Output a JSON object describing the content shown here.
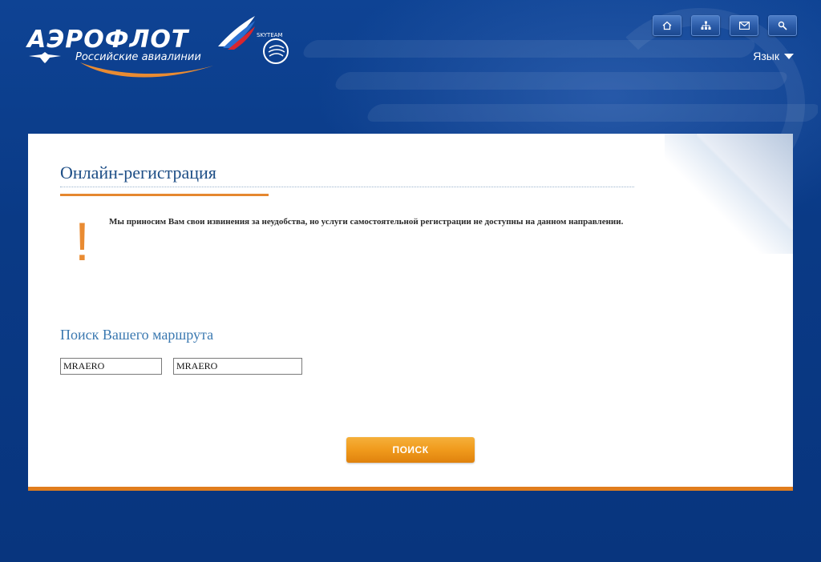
{
  "header": {
    "logo_text": "АЭРОФЛОТ",
    "logo_subtitle": "Российские авиалинии",
    "alliance": "SKYTEAM",
    "language_label": "Язык",
    "top_buttons": [
      "home-icon",
      "sitemap-icon",
      "mail-icon",
      "search-icon"
    ]
  },
  "main": {
    "title": "Онлайн-регистрация",
    "warning_mark": "!",
    "message": "Мы приносим Вам свои извинения за неудобства, но услуги самостоятельной регистрации не доступны на данном направлении.",
    "search_heading": "Поиск Вашего маршрута",
    "field1_value": "MRAERO",
    "field2_value": "MRAERO",
    "search_button": "ПОИСК"
  },
  "colors": {
    "background": "#0a3a86",
    "accent": "#e07d1d",
    "title": "#1d4e86"
  }
}
